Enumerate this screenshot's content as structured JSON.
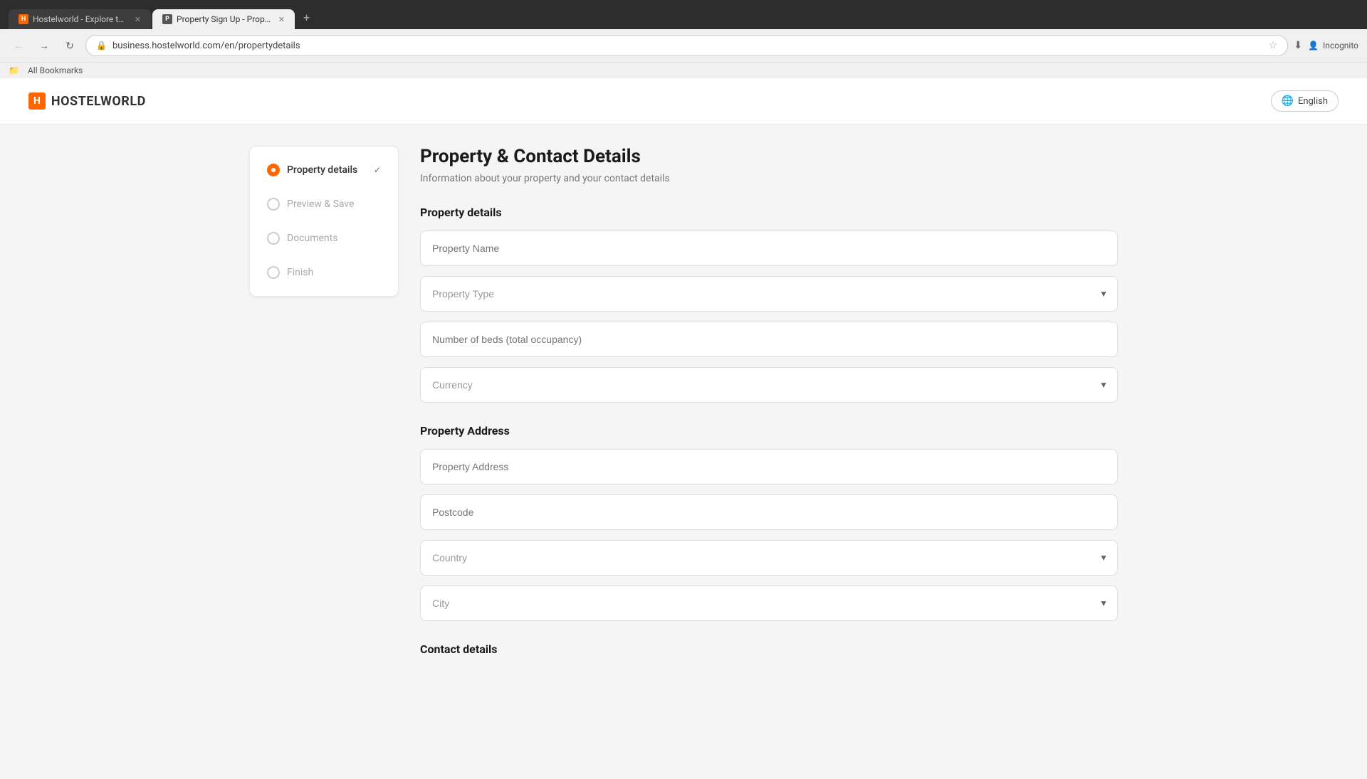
{
  "browser": {
    "tabs": [
      {
        "id": "tab1",
        "title": "Hostelworld - Explore the worl...",
        "active": false,
        "favicon": "H"
      },
      {
        "id": "tab2",
        "title": "Property Sign Up - Property an...",
        "active": true,
        "favicon": "P"
      }
    ],
    "new_tab_label": "+",
    "address_bar": {
      "url": "business.hostelworld.com/en/propertydetails",
      "lock_icon": "🔒"
    },
    "nav": {
      "back": "←",
      "forward": "→",
      "reload": "↻"
    },
    "bookmarks_bar_label": "All Bookmarks",
    "incognito_label": "Incognito"
  },
  "header": {
    "logo_box": "H",
    "logo_text": "HOSTELWORLD",
    "lang_button_label": "English",
    "globe_icon": "🌐"
  },
  "sidebar": {
    "items": [
      {
        "id": "property-details",
        "label": "Property details",
        "active": true,
        "radio_active": true,
        "show_check": true
      },
      {
        "id": "preview-save",
        "label": "Preview & Save",
        "active": false,
        "radio_active": false,
        "show_check": false
      },
      {
        "id": "documents",
        "label": "Documents",
        "active": false,
        "radio_active": false,
        "show_check": false
      },
      {
        "id": "finish",
        "label": "Finish",
        "active": false,
        "radio_active": false,
        "show_check": false
      }
    ]
  },
  "form": {
    "page_title": "Property & Contact Details",
    "page_subtitle": "Information about your property and your contact details",
    "property_details_section": {
      "title": "Property details",
      "fields": [
        {
          "id": "property-name",
          "type": "input",
          "placeholder": "Property Name"
        },
        {
          "id": "property-type",
          "type": "select",
          "placeholder": "Property Type"
        },
        {
          "id": "num-beds",
          "type": "input",
          "placeholder": "Number of beds (total occupancy)"
        },
        {
          "id": "currency",
          "type": "select",
          "placeholder": "Currency"
        }
      ]
    },
    "property_address_section": {
      "title": "Property Address",
      "fields": [
        {
          "id": "property-address",
          "type": "input",
          "placeholder": "Property Address"
        },
        {
          "id": "postcode",
          "type": "input",
          "placeholder": "Postcode"
        },
        {
          "id": "country",
          "type": "select",
          "placeholder": "Country"
        },
        {
          "id": "city",
          "type": "select",
          "placeholder": "City"
        }
      ]
    },
    "contact_section": {
      "title": "Contact details"
    }
  },
  "colors": {
    "accent": "#ff6600",
    "border": "#ddd",
    "text_muted": "#aaa",
    "text_dark": "#1a1a1a"
  }
}
